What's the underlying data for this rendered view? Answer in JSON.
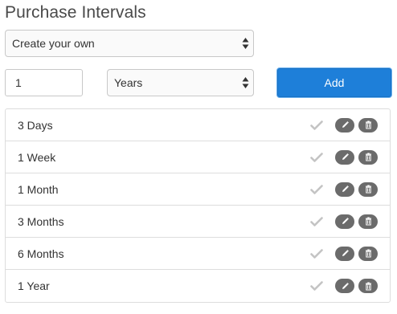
{
  "header": {
    "title": "Purchase Intervals"
  },
  "form": {
    "type_select_value": "Create your own",
    "quantity_value": "1",
    "unit_select_value": "Years",
    "add_label": "Add"
  },
  "intervals": [
    {
      "label": "3 Days"
    },
    {
      "label": "1 Week"
    },
    {
      "label": "1 Month"
    },
    {
      "label": "3 Months"
    },
    {
      "label": "6 Months"
    },
    {
      "label": "1 Year"
    }
  ],
  "icons": {
    "row_actions": [
      "check-icon",
      "pencil-icon",
      "trash-icon"
    ],
    "select_arrows": "updown-arrows-icon"
  },
  "colors": {
    "accent": "#1e7fd9",
    "action_button": "#6b6b6b",
    "check_disabled": "#c4c4c4"
  }
}
